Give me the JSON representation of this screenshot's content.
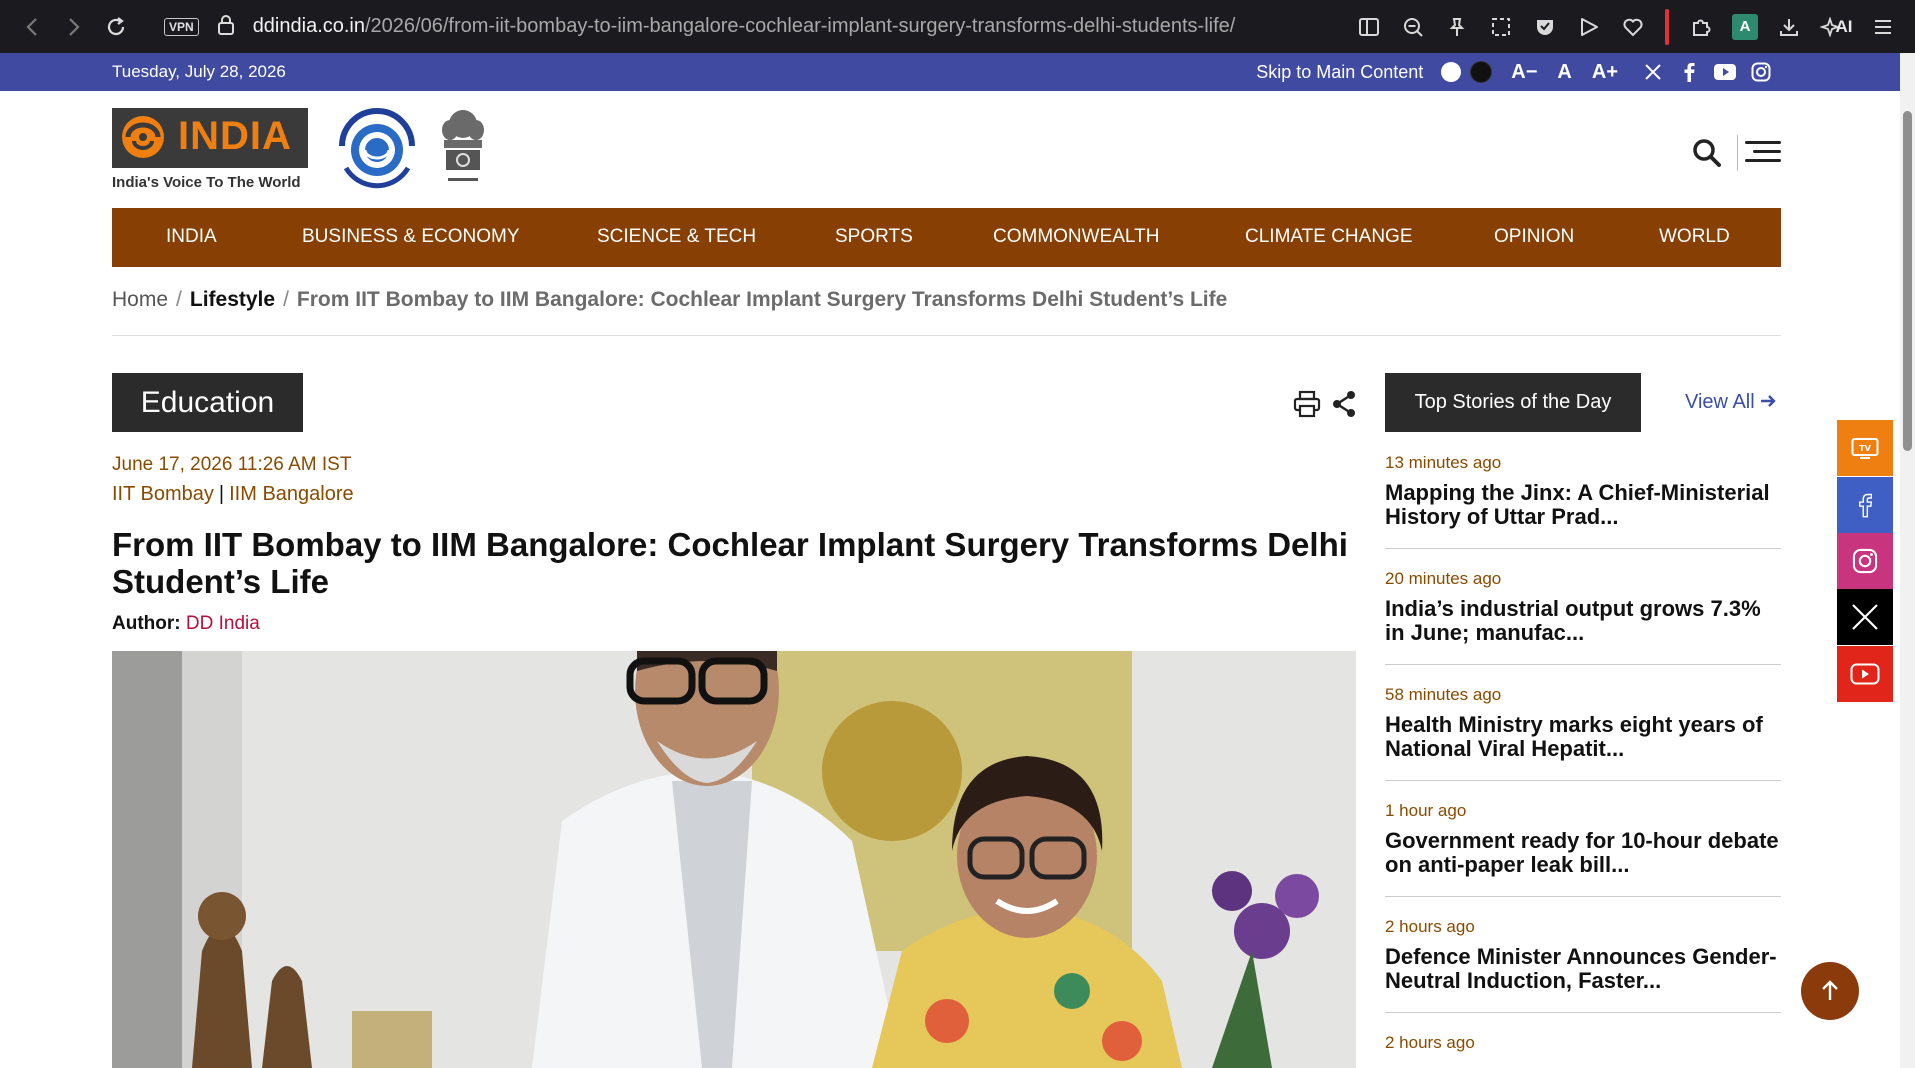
{
  "browser": {
    "vpn_label": "VPN",
    "url_host": "ddindia.co.in",
    "url_path": "/2026/06/from-iit-bombay-to-iim-bangalore-cochlear-implant-surgery-transforms-delhi-students-life/",
    "profile_initial": "A",
    "ai_label": "AI"
  },
  "topbar": {
    "date": "Tuesday, July 28, 2026",
    "skip_link": "Skip to Main Content",
    "font_decrease": "A−",
    "font_normal": "A",
    "font_increase": "A+"
  },
  "header": {
    "logo_text": "INDIA",
    "tagline": "India's Voice To The World"
  },
  "nav": {
    "items": [
      {
        "label": "INDIA"
      },
      {
        "label": "BUSINESS & ECONOMY"
      },
      {
        "label": "SCIENCE & TECH"
      },
      {
        "label": "SPORTS"
      },
      {
        "label": "COMMONWEALTH"
      },
      {
        "label": "CLIMATE CHANGE"
      },
      {
        "label": "OPINION"
      },
      {
        "label": "WORLD"
      }
    ]
  },
  "breadcrumb": {
    "home": "Home",
    "separator": "/",
    "category": "Lifestyle",
    "current": "From IIT Bombay to IIM Bangalore: Cochlear Implant Surgery Transforms Delhi Student’s Life"
  },
  "article": {
    "category": "Education",
    "date": "June 17, 2026 11:26 AM IST",
    "tags": [
      "IIT Bombay",
      "IIM Bangalore"
    ],
    "tag_separator": "|",
    "title": "From IIT Bombay to IIM Bangalore: Cochlear Implant Surgery Transforms Delhi Student’s Life",
    "author_label": "Author:",
    "author_name": "DD India"
  },
  "sidebar": {
    "heading": "Top Stories of the Day",
    "view_all": "View All",
    "stories": [
      {
        "ago": "13 minutes ago",
        "title": "Mapping the Jinx: A Chief-Ministerial History of Uttar Prad..."
      },
      {
        "ago": "20 minutes ago",
        "title": "India’s industrial output grows 7.3% in June; manufac..."
      },
      {
        "ago": "58 minutes ago",
        "title": "Health Ministry marks eight years of National Viral Hepatit..."
      },
      {
        "ago": "1 hour ago",
        "title": "Government ready for 10-hour debate on anti-paper leak bill..."
      },
      {
        "ago": "2 hours ago",
        "title": "Defence Minister Announces Gender-Neutral Induction, Faster..."
      },
      {
        "ago": "2 hours ago",
        "title": ""
      }
    ]
  },
  "social_rail": {
    "colors": {
      "tv": "#f07f12",
      "facebook": "#3f5fc4",
      "instagram": "#c8347e",
      "x": "#000000",
      "youtube": "#e1251b"
    },
    "tv_label": "TV"
  },
  "colors": {
    "topbar_bg": "#3f4aa0",
    "nav_bg": "#873f03",
    "accent_brown": "#8a4b00",
    "author_red": "#b80f3c",
    "link_blue": "#3d4fa5"
  }
}
